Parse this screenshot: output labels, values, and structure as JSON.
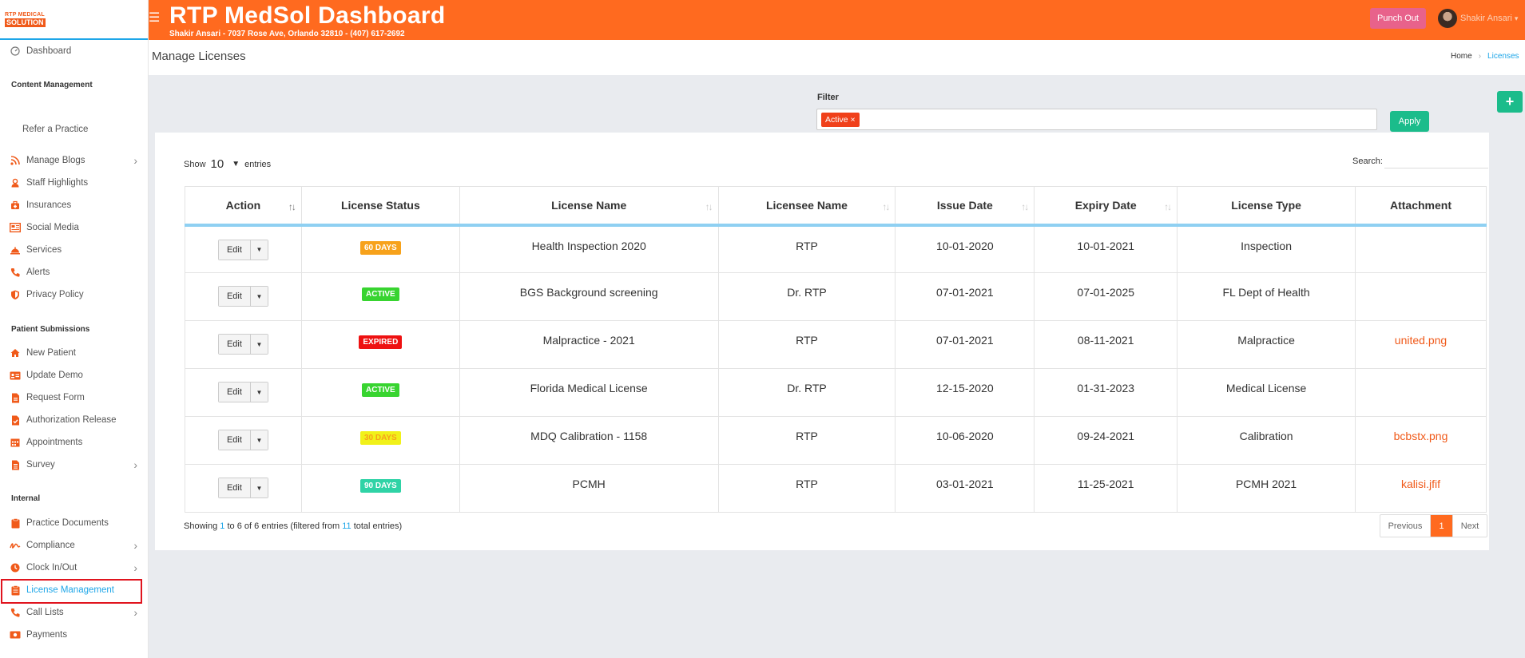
{
  "logo": {
    "top": "RTP MEDICAL",
    "bottom": "SOLUTION"
  },
  "header": {
    "title": "RTP MedSol Dashboard",
    "subtitle": "Shakir Ansari - 7037 Rose Ave, Orlando 32810 - (407) 617-2692",
    "punch_label": "Punch Out",
    "user_name": "Shakir Ansari"
  },
  "sidebar": {
    "dashboard": "Dashboard",
    "sections": {
      "content": "Content Management",
      "patient": "Patient Submissions",
      "internal": "Internal"
    },
    "refer": "Refer a Practice",
    "items": [
      {
        "label": "Manage Blogs",
        "icon": "rss-icon"
      },
      {
        "label": "Staff Highlights",
        "icon": "staff-icon"
      },
      {
        "label": "Insurances",
        "icon": "briefcase-icon"
      },
      {
        "label": "Social Media",
        "icon": "share-icon"
      },
      {
        "label": "Services",
        "icon": "bell-service-icon"
      },
      {
        "label": "Alerts",
        "icon": "phone-icon"
      },
      {
        "label": "Privacy Policy",
        "icon": "shield-icon"
      },
      {
        "label": "New Patient",
        "icon": "home-icon"
      },
      {
        "label": "Update Demo",
        "icon": "id-card-icon"
      },
      {
        "label": "Request Form",
        "icon": "file-icon"
      },
      {
        "label": "Authorization Release",
        "icon": "check-file-icon"
      },
      {
        "label": "Appointments",
        "icon": "calendar-icon"
      },
      {
        "label": "Survey",
        "icon": "survey-icon"
      },
      {
        "label": "Practice Documents",
        "icon": "clipboard-icon"
      },
      {
        "label": "Compliance",
        "icon": "signature-icon"
      },
      {
        "label": "Clock In/Out",
        "icon": "clock-icon"
      },
      {
        "label": "License Management",
        "icon": "list-file-icon"
      },
      {
        "label": "Call Lists",
        "icon": "phone-icon"
      },
      {
        "label": "Payments",
        "icon": "money-icon"
      }
    ]
  },
  "page": {
    "title": "Manage Licenses",
    "breadcrumb_home": "Home",
    "breadcrumb_current": "Licenses"
  },
  "filter": {
    "label": "Filter",
    "chip": "Active ×",
    "apply": "Apply",
    "add": "+"
  },
  "table_controls": {
    "show": "Show",
    "entries_value": "10",
    "entries": "entries",
    "search": "Search:"
  },
  "table": {
    "headers": [
      "Action",
      "License Status",
      "License Name",
      "Licensee Name",
      "Issue Date",
      "Expiry Date",
      "License Type",
      "Attachment"
    ],
    "edit_label": "Edit",
    "rows": [
      {
        "status": "60 DAYS",
        "status_color": "#f7a21b",
        "name": "Health Inspection 2020",
        "licensee": "RTP",
        "issue": "10-01-2020",
        "expiry": "10-01-2021",
        "type": "Inspection",
        "attachment": ""
      },
      {
        "status": "ACTIVE",
        "status_color": "#38d430",
        "name": "BGS Background screening",
        "licensee": "Dr. RTP",
        "issue": "07-01-2021",
        "expiry": "07-01-2025",
        "type": "FL Dept of Health",
        "attachment": ""
      },
      {
        "status": "EXPIRED",
        "status_color": "#ee1111",
        "name": "Malpractice - 2021",
        "licensee": "RTP",
        "issue": "07-01-2021",
        "expiry": "08-11-2021",
        "type": "Malpractice",
        "attachment": "united.png"
      },
      {
        "status": "ACTIVE",
        "status_color": "#38d430",
        "name": "Florida Medical License",
        "licensee": "Dr. RTP",
        "issue": "12-15-2020",
        "expiry": "01-31-2023",
        "type": "Medical License",
        "attachment": ""
      },
      {
        "status": "30 DAYS",
        "status_color": "#f1f11a",
        "name": "MDQ Calibration - 1158",
        "licensee": "RTP",
        "issue": "10-06-2020",
        "expiry": "09-24-2021",
        "type": "Calibration",
        "attachment": "bcbstx.png"
      },
      {
        "status": "90 DAYS",
        "status_color": "#2fd3a6",
        "name": "PCMH",
        "licensee": "RTP",
        "issue": "03-01-2021",
        "expiry": "11-25-2021",
        "type": "PCMH 2021",
        "attachment": "kalisi.jfif"
      }
    ]
  },
  "footer": {
    "showing": "Showing",
    "from": "1",
    "to_text": "to",
    "to": "6",
    "of_text": "of",
    "total": "6",
    "entries_filtered": "entries (filtered from",
    "grand_total": "11",
    "total_entries": "total entries)",
    "prev": "Previous",
    "page": "1",
    "next": "Next"
  },
  "colors": {
    "brand": "#ff6a1f",
    "accent": "#1ea6e8",
    "success": "#1bbc8b",
    "highlight": "#e0141e"
  }
}
